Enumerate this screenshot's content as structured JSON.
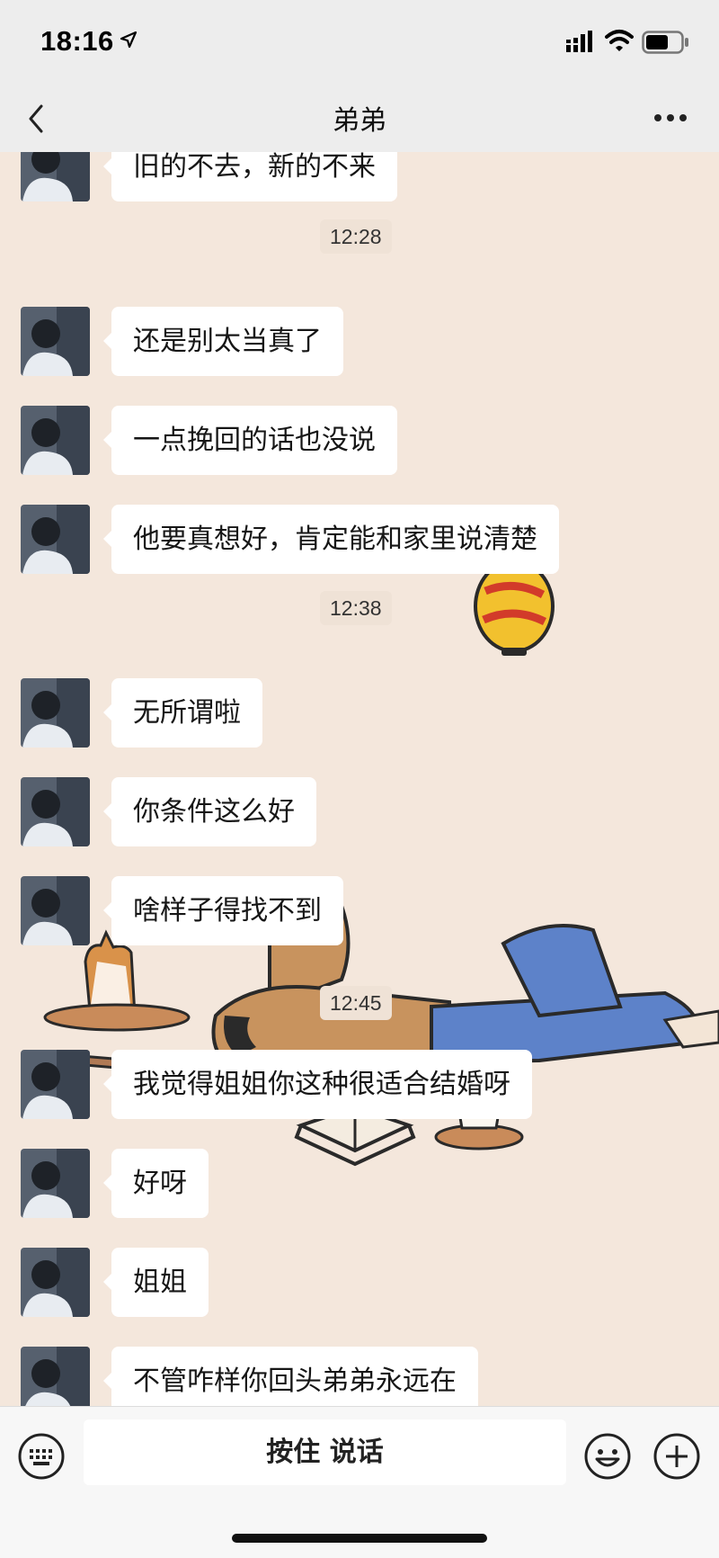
{
  "status_bar": {
    "time": "18:16",
    "icons": [
      "location-arrow-icon",
      "cellular-signal-icon",
      "wifi-icon",
      "battery-icon"
    ]
  },
  "nav": {
    "title": "弟弟",
    "left_icon": "back-chevron-icon",
    "right_icon": "more-icon"
  },
  "messages": [
    {
      "type": "message",
      "text": "旧的不去，新的不来"
    },
    {
      "type": "time",
      "text": "12:28"
    },
    {
      "type": "message",
      "text": "还是别太当真了"
    },
    {
      "type": "message",
      "text": "一点挽回的话也没说"
    },
    {
      "type": "message",
      "text": "他要真想好，肯定能和家里说清楚"
    },
    {
      "type": "time",
      "text": "12:38"
    },
    {
      "type": "message",
      "text": "无所谓啦"
    },
    {
      "type": "message",
      "text": "你条件这么好"
    },
    {
      "type": "message",
      "text": "啥样子得找不到"
    },
    {
      "type": "time",
      "text": "12:45"
    },
    {
      "type": "message",
      "text": "我觉得姐姐你这种很适合结婚呀"
    },
    {
      "type": "message",
      "text": "好呀"
    },
    {
      "type": "message",
      "text": "姐姐"
    },
    {
      "type": "message",
      "text": "不管咋样你回头弟弟永远在"
    }
  ],
  "input_bar": {
    "voice_label": "按住 说话",
    "icons": [
      "keyboard-icon",
      "emoji-icon",
      "plus-icon"
    ]
  },
  "colors": {
    "bar_bg": "#ededed",
    "chat_bg": "#f4e7dc",
    "bubble": "#ffffff",
    "timestamp_bg": "#efe2d6"
  }
}
